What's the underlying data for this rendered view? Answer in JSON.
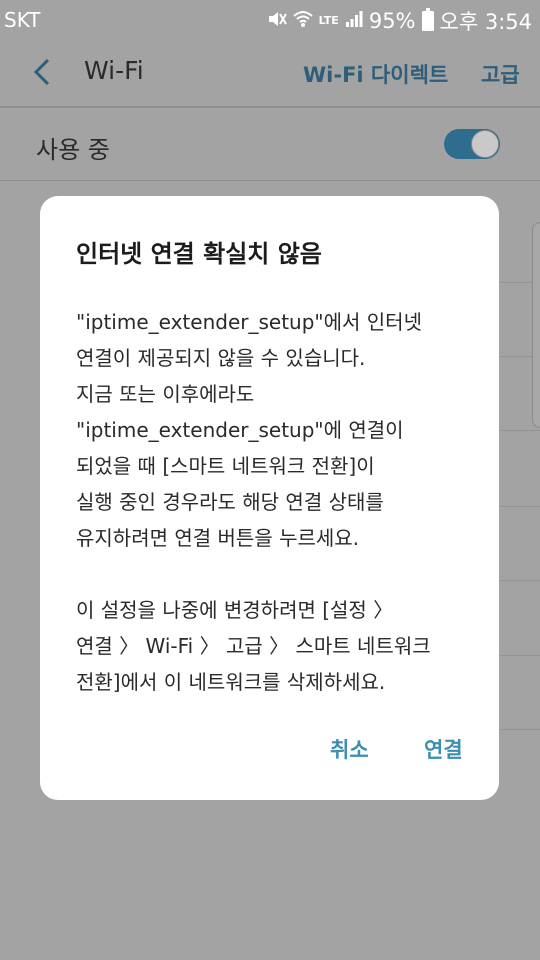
{
  "status_bar": {
    "carrier": "SKT",
    "battery_percent": "95%",
    "time": "오후 3:54",
    "icons": [
      "mute-icon",
      "wifi-icon",
      "lte-icon",
      "signal-icon",
      "battery-icon"
    ],
    "lte_label": "LTE"
  },
  "app_bar": {
    "title": "Wi-Fi",
    "wifi_direct": "Wi-Fi 다이렉트",
    "advanced": "고급"
  },
  "wifi_toggle": {
    "label": "사용 중",
    "on": true
  },
  "dialog": {
    "title": "인터넷 연결 확실치 않음",
    "body_lines": [
      "\"iptime_extender_setup\"에서 인터넷",
      "연결이 제공되지 않을 수 있습니다.",
      "지금 또는 이후에라도",
      "\"iptime_extender_setup\"에 연결이",
      "되었을 때 [스마트 네트워크 전환]이",
      "실행 중인 경우라도 해당 연결 상태를",
      "유지하려면 연결 버튼을 누르세요.",
      "",
      "이 설정을 나중에 변경하려면 [설정 〉",
      "연결 〉 Wi-Fi 〉 고급 〉 스마트 네트워크",
      "전환]에서 이 네트워크를 삭제하세요."
    ],
    "cancel_label": "취소",
    "connect_label": "연결"
  },
  "colors": {
    "accent": "#3b8fb0",
    "dimmed_background": "#a3a3a3",
    "toggle_on": "#2e6d8e"
  }
}
